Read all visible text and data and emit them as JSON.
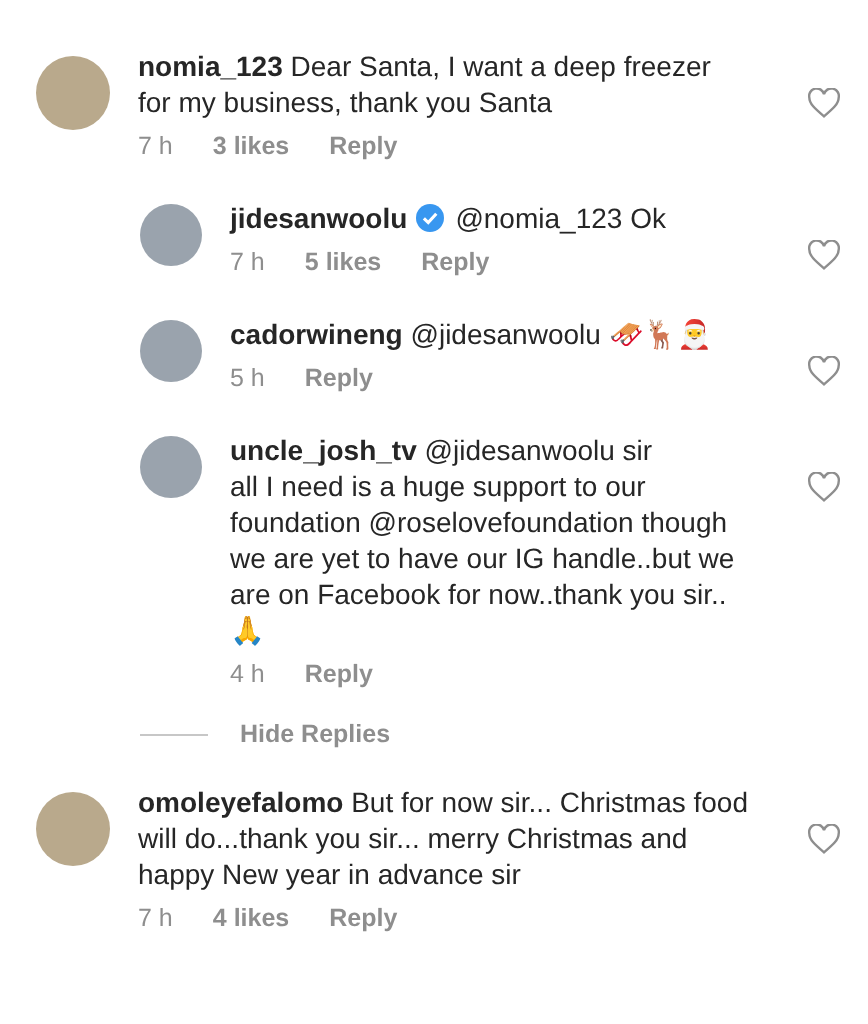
{
  "comments": [
    {
      "username": "nomia_123",
      "verified": false,
      "text": "Dear Santa, I want a deep freezer for my business, thank you Santa",
      "time": "7 h",
      "likes": "3 likes",
      "reply": "Reply",
      "replies": [
        {
          "username": "jidesanwoolu",
          "verified": true,
          "text": "@nomia_123 Ok",
          "time": "7 h",
          "likes": "5 likes",
          "reply": "Reply"
        },
        {
          "username": "cadorwineng",
          "verified": false,
          "text": "@jidesanwoolu 🛷🦌🎅",
          "time": "5 h",
          "reply": "Reply"
        },
        {
          "username": "uncle_josh_tv",
          "verified": false,
          "text": "@jidesanwoolu sir\nall I need is a huge support to our foundation @roselovefoundation though we are yet to have our IG handle..but we are on Facebook for now..thank you sir..\n🙏",
          "time": "4 h",
          "reply": "Reply"
        }
      ],
      "hide_replies": "Hide Replies"
    },
    {
      "username": "omoleyefalomo",
      "verified": false,
      "text": "But for now sir... Christmas food will do...thank you sir... merry Christmas and happy New year in advance sir",
      "time": "7 h",
      "likes": "4 likes",
      "reply": "Reply"
    }
  ]
}
